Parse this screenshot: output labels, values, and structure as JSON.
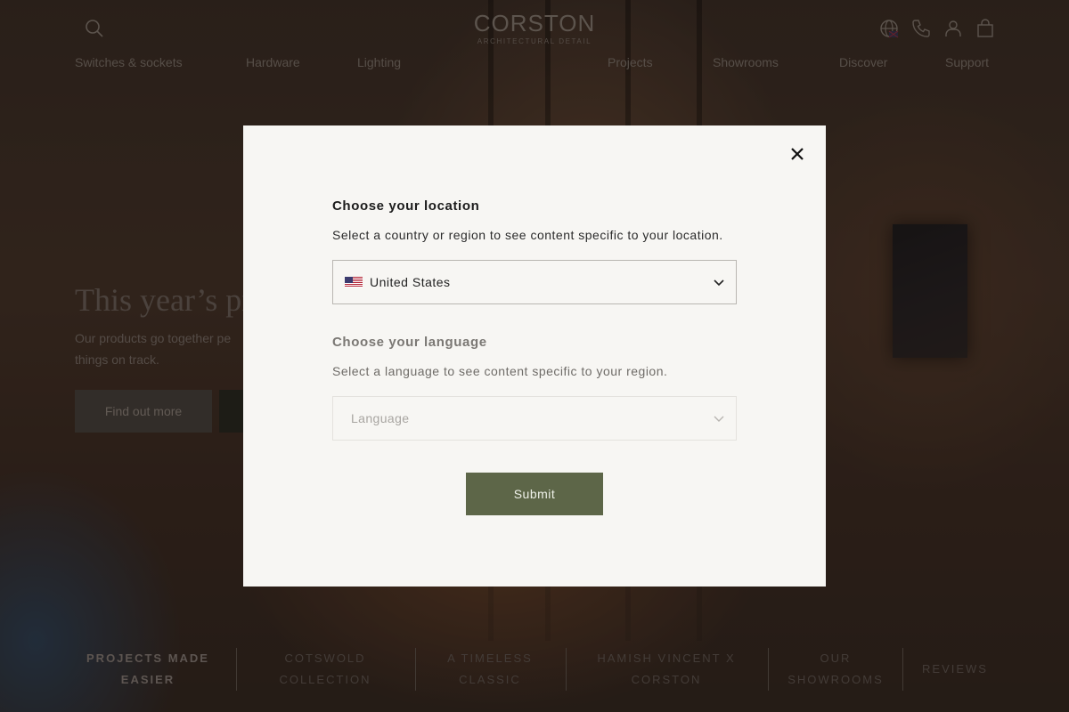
{
  "header": {
    "logo": {
      "name": "CORSTON",
      "tagline": "ARCHITECTURAL DETAIL"
    },
    "icons": [
      "search-icon",
      "globe-icon",
      "phone-icon",
      "account-icon",
      "bag-icon"
    ],
    "nav_left": [
      "Switches & sockets",
      "Hardware",
      "Lighting"
    ],
    "nav_right": [
      "Projects",
      "Showrooms",
      "Discover",
      "Support"
    ]
  },
  "hero": {
    "title": "This year’s pr",
    "text_line1": "Our products go together pe",
    "text_line2": "things on track.",
    "button_label": "Find out more"
  },
  "bottom_tabs": [
    {
      "line1": "PROJECTS MADE",
      "line2": "EASIER"
    },
    {
      "line1": "COTSWOLD",
      "line2": "COLLECTION"
    },
    {
      "line1": "A TIMELESS",
      "line2": "CLASSIC"
    },
    {
      "line1": "HAMISH VINCENT X",
      "line2": "CORSTON"
    },
    {
      "line1": "OUR",
      "line2": "SHOWROOMS"
    },
    {
      "line1": "REVIEWS",
      "line2": ""
    }
  ],
  "modal": {
    "location": {
      "title": "Choose your location",
      "description": "Select a country or region to see content specific to your location.",
      "selected": "United States",
      "flag": "us-flag-icon"
    },
    "language": {
      "title": "Choose your language",
      "description": "Select a language to see content specific to your region.",
      "placeholder": "Language"
    },
    "submit_label": "Submit",
    "close_icon": "close-icon"
  },
  "colors": {
    "modal_bg": "#f7f6f3",
    "submit_bg": "#5d6648",
    "overlay": "#120e0c"
  }
}
